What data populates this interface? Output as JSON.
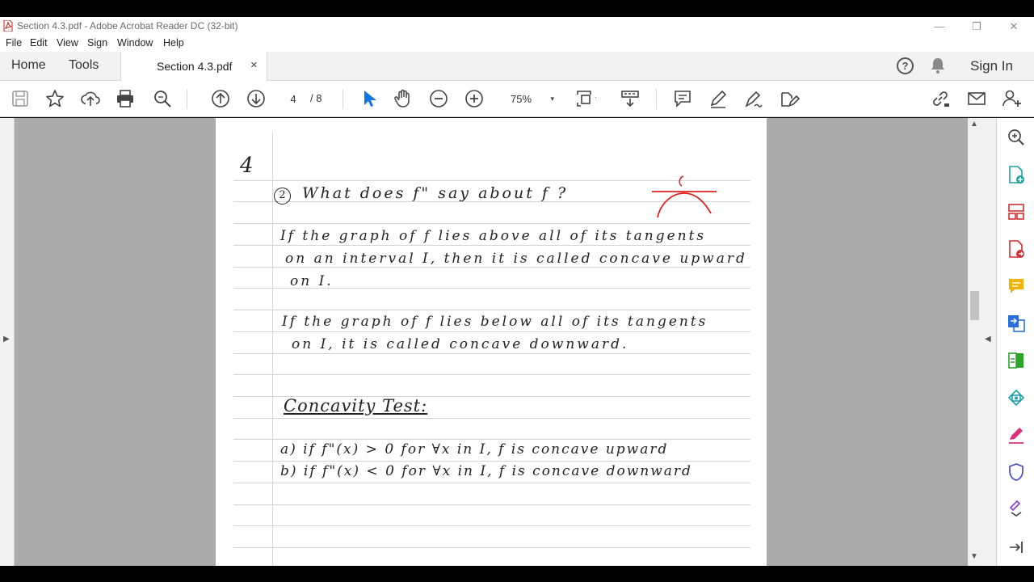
{
  "window": {
    "title": "Section 4.3.pdf - Adobe Acrobat Reader DC (32-bit)",
    "minimize": "—",
    "restore": "❐",
    "close": "✕"
  },
  "menu": [
    "File",
    "Edit",
    "View",
    "Sign",
    "Window",
    "Help"
  ],
  "tabs": {
    "home": "Home",
    "tools": "Tools",
    "document": "Section 4.3.pdf",
    "close": "×",
    "help": "?",
    "sign_in": "Sign In"
  },
  "toolbar": {
    "page_current": "4",
    "page_total": "/ 8",
    "zoom": "75%",
    "zoom_caret": "▾"
  },
  "page": {
    "page_number": "4",
    "q_number": "2",
    "question": "What does f\" say about f ?",
    "diagram_label": "c",
    "line1": "If the graph of f lies above all of its tangents",
    "line2": "on an interval I, then it is called concave upward",
    "line3": "on I.",
    "line4": "If the graph of f lies below all of its tangents",
    "line5": "on I, it is called concave downward.",
    "heading": "Concavity Test:",
    "test_a": "a) if f\"(x) > 0 for ∀x in I, f is concave upward",
    "test_b": "b) if f\"(x) < 0 for ∀x in I, f is concave downward"
  },
  "colors": {
    "accent_blue": "#1473e6",
    "annotation_red": "#e02020",
    "workspace_gray": "#ababab"
  },
  "icons": [
    "save-icon",
    "bookmark-star-icon",
    "upload-icon",
    "print-icon",
    "search-icon",
    "page-up-icon",
    "page-down-icon",
    "select-arrow-icon",
    "hand-icon",
    "zoom-out-icon",
    "zoom-in-icon",
    "fit-page-icon",
    "scroll-mode-icon",
    "comment-icon",
    "pen-icon",
    "sign-icon",
    "edit-pdf-icon",
    "share-link-icon",
    "email-icon",
    "add-user-icon"
  ]
}
